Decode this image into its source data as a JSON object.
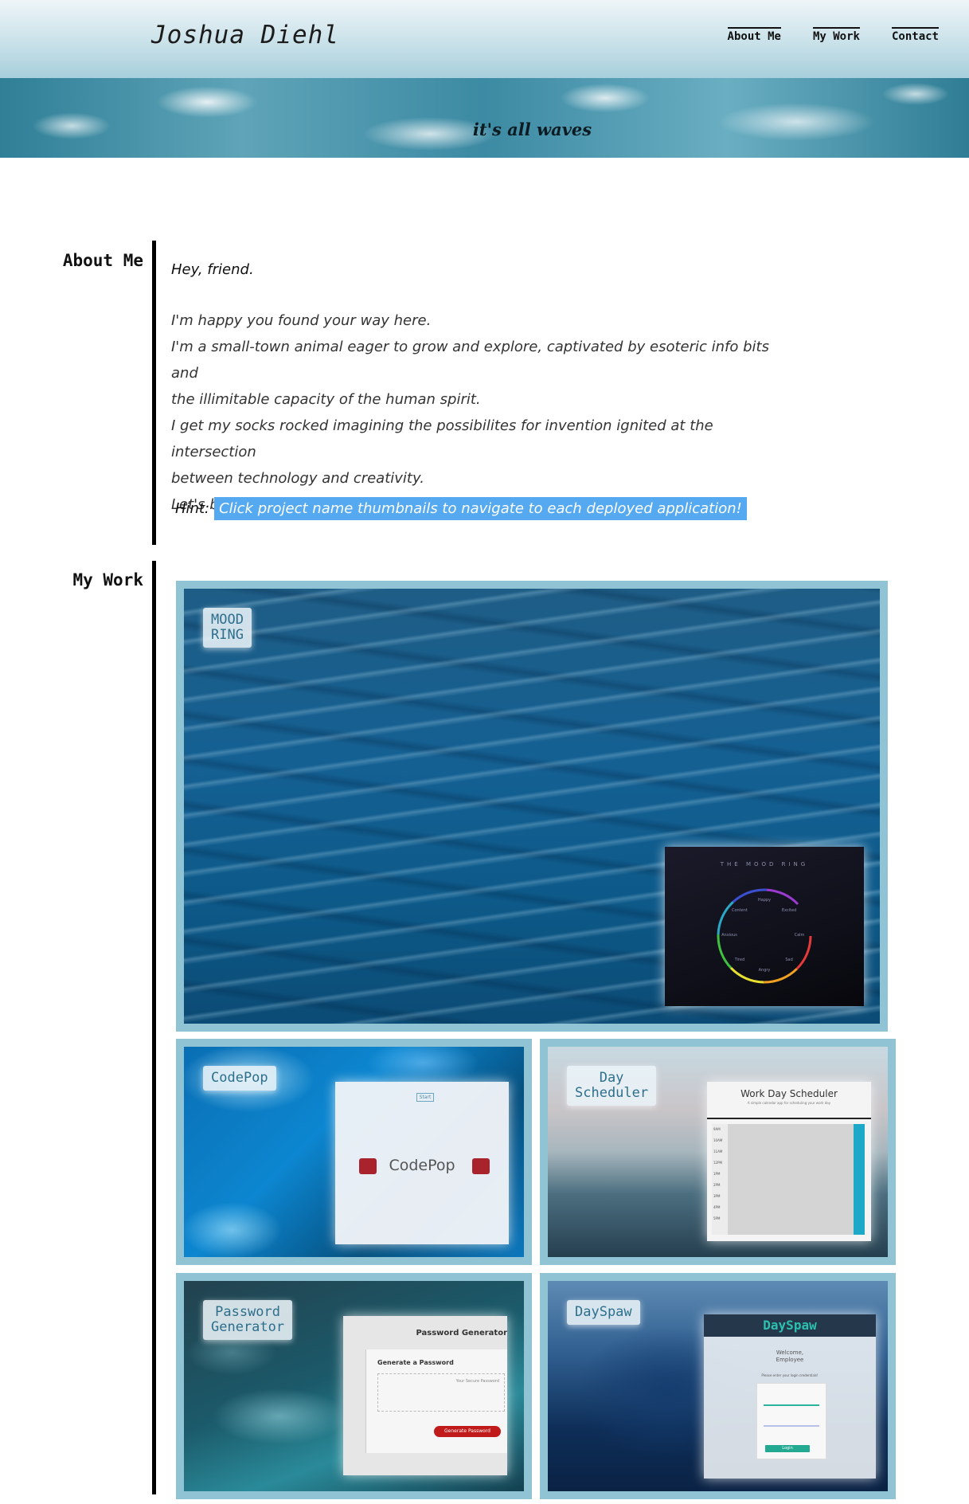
{
  "header": {
    "brand": "Joshua Diehl",
    "nav": [
      "About Me",
      "My Work",
      "Contact"
    ]
  },
  "banner": {
    "tagline": "it's all waves"
  },
  "about": {
    "label": "About Me",
    "greeting": "Hey, friend.",
    "lines": [
      "I'm happy you found your way here.",
      "I'm a small-town animal eager to grow and explore, captivated by esoteric info bits and",
      "the illimitable capacity of the human spirit.",
      "I get my socks rocked imagining the possibilites for invention ignited at the intersection",
      "between technology and creativity.",
      "Let's build a better world!"
    ],
    "hint_label": "Hint:",
    "hint_text": "Click project name thumbnails to navigate to each deployed application!"
  },
  "work": {
    "label": "My Work",
    "projects": [
      {
        "name": "MOOD RING",
        "name_lines": [
          "MOOD",
          "RING"
        ],
        "preview_title": "THE MOOD RING",
        "wheel_labels": [
          "Happy",
          "Excited",
          "Calm",
          "Sad",
          "Angry",
          "Tired",
          "Anxious",
          "Content"
        ]
      },
      {
        "name": "CodePop",
        "preview_title": "CodePop",
        "preview_button": "Start"
      },
      {
        "name": "Day Scheduler",
        "name_lines": [
          "Day",
          "Scheduler"
        ],
        "preview_title": "Work Day Scheduler",
        "preview_subtitle": "A simple calendar app for scheduling your work day",
        "hours": [
          "9AM",
          "10AM",
          "11AM",
          "12PM",
          "1PM",
          "2PM",
          "3PM",
          "4PM",
          "5PM"
        ]
      },
      {
        "name": "Password Generator",
        "name_lines": [
          "Password",
          "Generator"
        ],
        "preview_header": "Password Generator",
        "preview_subheader": "Generate a Password",
        "preview_placeholder": "Your Secure Password",
        "preview_button": "Generate Password"
      },
      {
        "name": "DaySpaw",
        "preview_brand": "DaySpaw",
        "preview_welcome": [
          "Welcome,",
          "Employee"
        ],
        "preview_prompt": "Please enter your login credentials!",
        "preview_button": "Login"
      }
    ]
  },
  "colors": {
    "card_border": "#90c4d5",
    "hint_bg": "#55a9f0",
    "label_text": "#2d6f8c"
  }
}
